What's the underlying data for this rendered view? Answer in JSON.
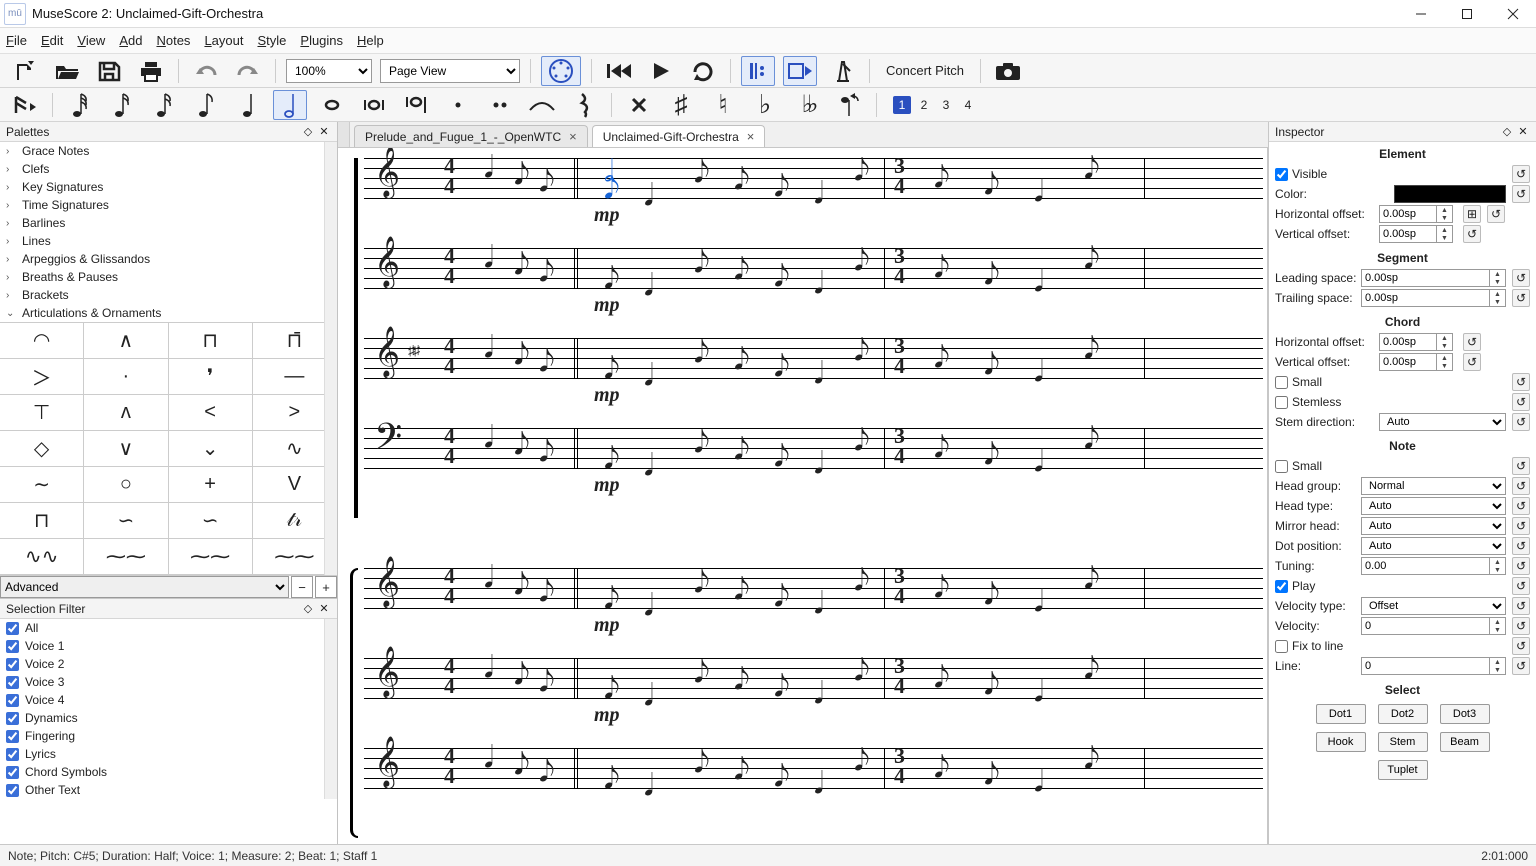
{
  "window": {
    "title": "MuseScore 2: Unclaimed-Gift-Orchestra",
    "app_icon": "mū"
  },
  "menu": [
    "File",
    "Edit",
    "View",
    "Add",
    "Notes",
    "Layout",
    "Style",
    "Plugins",
    "Help"
  ],
  "toolbar1": {
    "zoom": "100%",
    "view_mode": "Page View",
    "concert_pitch": "Concert Pitch"
  },
  "toolbar2": {
    "voices": [
      "1",
      "2",
      "3",
      "4"
    ],
    "active_voice": 0
  },
  "palettes": {
    "title": "Palettes",
    "items": [
      {
        "label": "Grace Notes",
        "open": false
      },
      {
        "label": "Clefs",
        "open": false
      },
      {
        "label": "Key Signatures",
        "open": false
      },
      {
        "label": "Time Signatures",
        "open": false
      },
      {
        "label": "Barlines",
        "open": false
      },
      {
        "label": "Lines",
        "open": false
      },
      {
        "label": "Arpeggios & Glissandos",
        "open": false
      },
      {
        "label": "Breaths & Pauses",
        "open": false
      },
      {
        "label": "Brackets",
        "open": false
      },
      {
        "label": "Articulations & Ornaments",
        "open": true
      }
    ],
    "grid": [
      "◠",
      "∧",
      "⊓",
      "⊓̄",
      "＞",
      "·",
      "❜",
      "—",
      "⊤",
      "ʌ",
      "<",
      ">",
      "◇",
      "∨",
      "⌄",
      "∿",
      "∼",
      "○",
      "+",
      "V",
      "⊓",
      "∽",
      "∽",
      "𝓉𝓇",
      "∿∿",
      "⁓⁓",
      "⁓⁓",
      "⁓⁓"
    ],
    "advanced": "Advanced"
  },
  "selection_filter": {
    "title": "Selection Filter",
    "items": [
      "All",
      "Voice 1",
      "Voice 2",
      "Voice 3",
      "Voice 4",
      "Dynamics",
      "Fingering",
      "Lyrics",
      "Chord Symbols",
      "Other Text"
    ]
  },
  "tabs": [
    {
      "label": "Prelude_and_Fugue_1_-_OpenWTC",
      "active": false
    },
    {
      "label": "Unclaimed-Gift-Orchestra",
      "active": true
    }
  ],
  "score": {
    "timesig_a": "4/4",
    "timesig_b": "3/4",
    "dynamic": "mp",
    "selected_note_color": "#1864d6"
  },
  "inspector": {
    "title": "Inspector",
    "element": {
      "heading": "Element",
      "visible": true,
      "visible_label": "Visible",
      "color_label": "Color:",
      "color": "#000000",
      "hoff_label": "Horizontal offset:",
      "hoff": "0.00sp",
      "voff_label": "Vertical offset:",
      "voff": "0.00sp"
    },
    "segment": {
      "heading": "Segment",
      "lead_label": "Leading space:",
      "lead": "0.00sp",
      "trail_label": "Trailing space:",
      "trail": "0.00sp"
    },
    "chord": {
      "heading": "Chord",
      "hoff_label": "Horizontal offset:",
      "hoff": "0.00sp",
      "voff_label": "Vertical offset:",
      "voff": "0.00sp",
      "small_label": "Small",
      "small": false,
      "stemless_label": "Stemless",
      "stemless": false,
      "stemdir_label": "Stem direction:",
      "stemdir": "Auto"
    },
    "note": {
      "heading": "Note",
      "small_label": "Small",
      "small": false,
      "head_group_label": "Head group:",
      "head_group": "Normal",
      "head_type_label": "Head type:",
      "head_type": "Auto",
      "mirror_label": "Mirror head:",
      "mirror": "Auto",
      "dot_label": "Dot position:",
      "dot": "Auto",
      "tuning_label": "Tuning:",
      "tuning": "0.00",
      "play_label": "Play",
      "play": true,
      "vel_type_label": "Velocity type:",
      "vel_type": "Offset",
      "vel_label": "Velocity:",
      "vel": "0",
      "fix_label": "Fix to line",
      "fix": false,
      "line_label": "Line:",
      "line": "0"
    },
    "select": {
      "heading": "Select",
      "buttons": [
        "Dot1",
        "Dot2",
        "Dot3",
        "Hook",
        "Stem",
        "Beam",
        "Tuplet"
      ]
    }
  },
  "status": {
    "left": "Note; Pitch: C#5; Duration: Half; Voice: 1;  Measure: 2; Beat: 1; Staff 1",
    "right": "2:01:000"
  }
}
